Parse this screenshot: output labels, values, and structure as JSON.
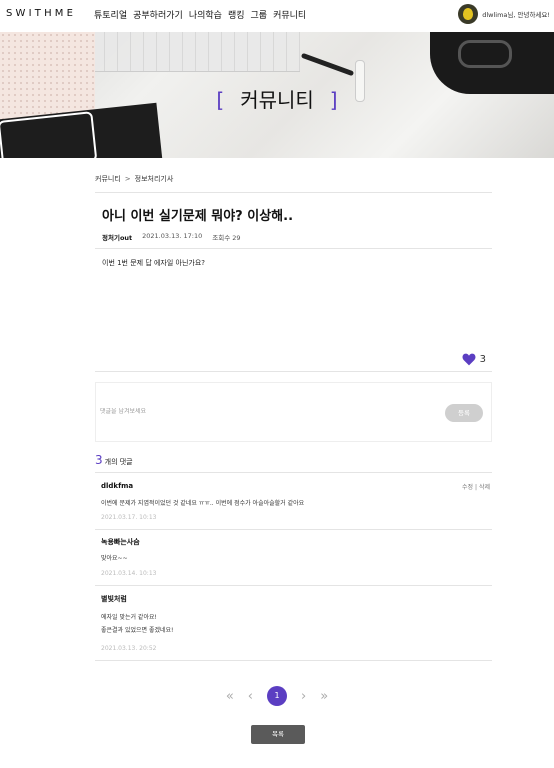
{
  "nav": {
    "logo": "SWITHME",
    "menu": [
      "튜토리얼",
      "공부하러가기",
      "나의학습",
      "랭킹",
      "그룹",
      "커뮤니티"
    ],
    "greeting": "dlwlima님, 안녕하세요!"
  },
  "banner": {
    "title": "커뮤니티",
    "bracket_left": "[",
    "bracket_right": "]"
  },
  "breadcrumb": {
    "root": "커뮤니티",
    "sep": ">",
    "board": "정보처리기사"
  },
  "post": {
    "title": "아니 이번 실기문제 뭐야? 이상해..",
    "author": "정처기out",
    "date": "2021.03.13. 17:10",
    "views": "조회수 29",
    "body": "이번 1번 문제 답 에자일 아닌가요?",
    "likes": "3"
  },
  "comment_form": {
    "placeholder": "댓글을 남겨보세요",
    "submit": "등록"
  },
  "comments_count": {
    "num": "3",
    "label": "개의 댓글"
  },
  "comments": [
    {
      "name": "dldkfma",
      "text": "이번에 문제가 지엽적이었던 것 같네요 ㅠㅠ.. 이번에 점수가 아슬아슬할거 같아요",
      "date": "2021.03.17. 10:13",
      "edit": "수정",
      "sep": "|",
      "delete": "삭제"
    },
    {
      "name": "녹용빠는사슴",
      "text": "맞아요~~",
      "date": "2021.03.14. 10:13"
    },
    {
      "name": "별빛처럼",
      "text": "에자일 맞는거 같아요!",
      "text2": "좋은결과 있었으면 좋겠네요!",
      "date": "2021.03.13. 20:52"
    }
  ],
  "pager": {
    "first": "«",
    "prev": "‹",
    "current": "1",
    "next": "›",
    "last": "»"
  },
  "list_button": "목록",
  "colors": {
    "accent": "#5b3ec2",
    "button_gray": "#5a5a5a"
  }
}
